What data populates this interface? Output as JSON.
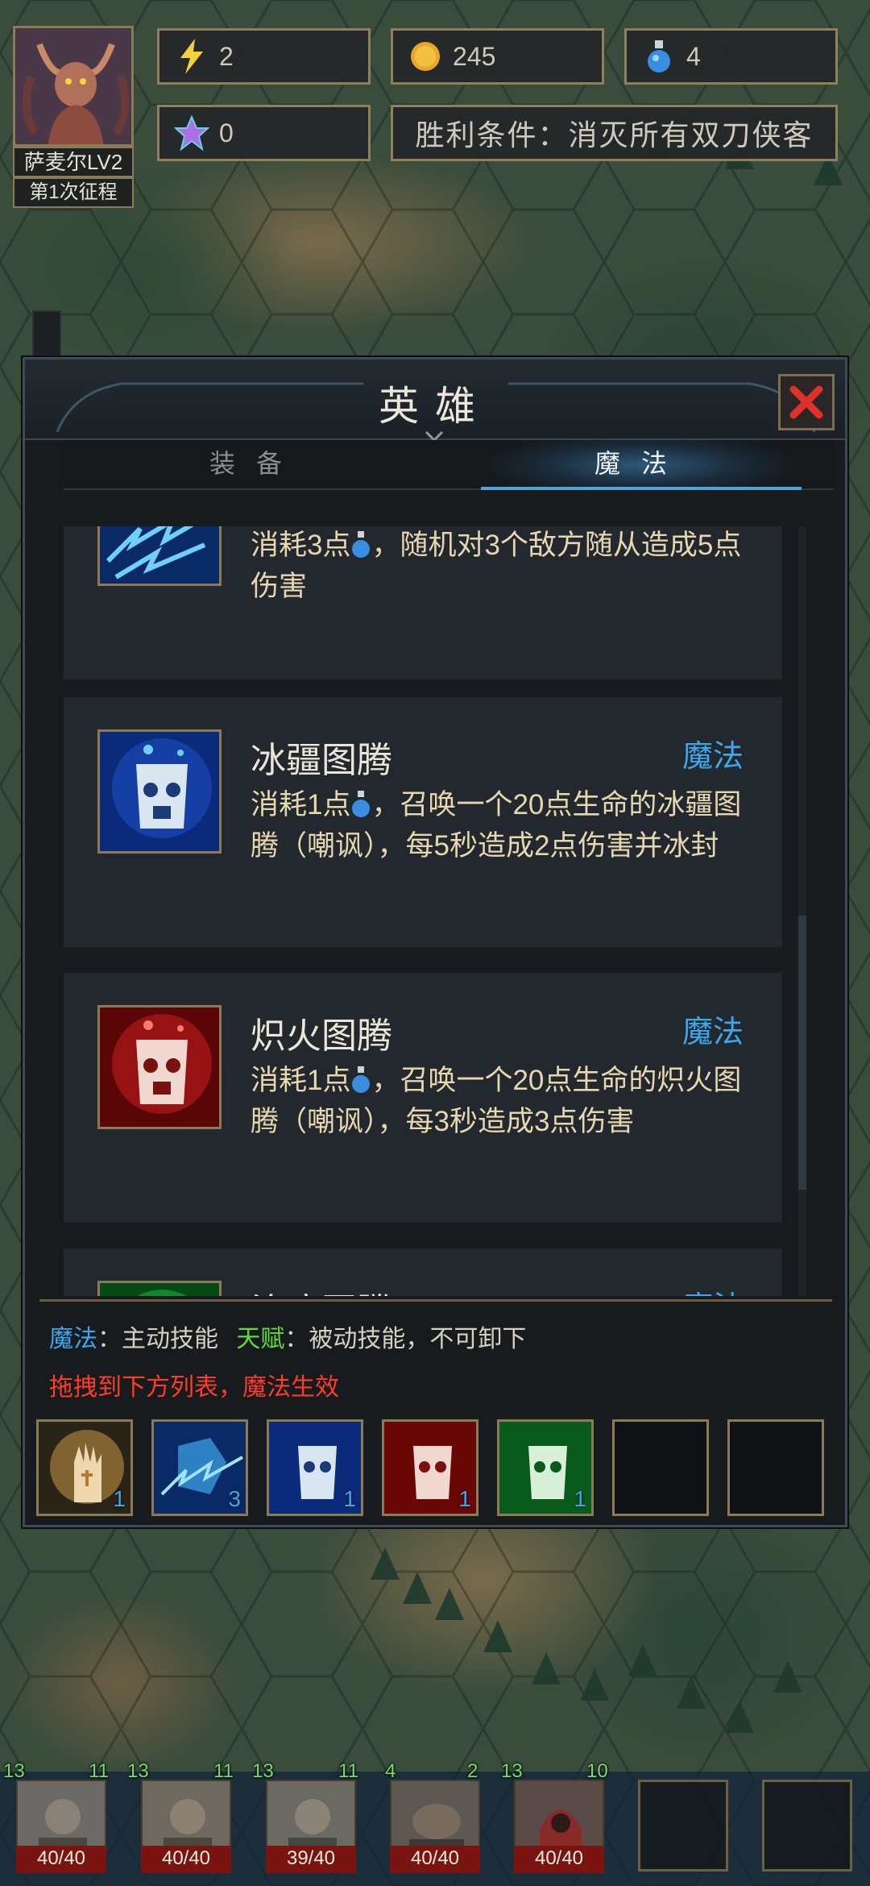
{
  "hud": {
    "hero_name": "萨麦尔LV2",
    "expedition": "第1次征程",
    "energy": "2",
    "gold": "245",
    "mana_potions": "4",
    "crystals": "0",
    "victory_condition": "胜利条件：消灭所有双刀侠客"
  },
  "panel": {
    "title": "英雄",
    "tabs": [
      {
        "label": "装备",
        "active": false
      },
      {
        "label": "魔法",
        "active": true
      }
    ]
  },
  "skills": [
    {
      "name": "",
      "type": "",
      "desc_a": "消耗3点",
      "desc_b": "，随机对3个敌方随从造成5点伤害",
      "icon": "lightning-storm-icon"
    },
    {
      "name": "冰疆图腾",
      "type": "魔法",
      "desc_a": "消耗1点",
      "desc_b": "，召唤一个20点生命的冰疆图腾（嘲讽），每5秒造成2点伤害并冰封",
      "icon": "ice-totem-icon"
    },
    {
      "name": "炽火图腾",
      "type": "魔法",
      "desc_a": "消耗1点",
      "desc_b": "，召唤一个20点生命的炽火图腾（嘲讽），每3秒造成3点伤害",
      "icon": "fire-totem-icon"
    },
    {
      "name": "治疗图腾",
      "type": "魔法",
      "desc_a": "",
      "desc_b": "",
      "icon": "heal-totem-icon"
    }
  ],
  "legend": {
    "magic_key": "魔法",
    "magic_desc": "：主动技能",
    "talent_key": "天赋",
    "talent_desc": "：被动技能，不可卸下",
    "drag_tip": "拖拽到下方列表，魔法生效"
  },
  "equipped": [
    {
      "icon": "holy-hand-icon",
      "count": "1"
    },
    {
      "icon": "lightning-storm-icon",
      "count": "3"
    },
    {
      "icon": "ice-totem-icon",
      "count": "1"
    },
    {
      "icon": "fire-totem-icon",
      "count": "1"
    },
    {
      "icon": "heal-totem-icon",
      "count": "1"
    },
    {
      "icon": "",
      "count": ""
    },
    {
      "icon": "",
      "count": ""
    }
  ],
  "units": [
    {
      "atk": "13",
      "def": "11",
      "hp": "40/40"
    },
    {
      "atk": "13",
      "def": "11",
      "hp": "40/40"
    },
    {
      "atk": "13",
      "def": "11",
      "hp": "39/40"
    },
    {
      "atk": "4",
      "def": "2",
      "hp": "40/40"
    },
    {
      "atk": "13",
      "def": "10",
      "hp": "40/40"
    }
  ],
  "colors": {
    "magic_blue": "#3aa8ea",
    "talent_green": "#5fdc3a",
    "warning_red": "#ff3c28",
    "frame_gold": "#8a7a55"
  }
}
